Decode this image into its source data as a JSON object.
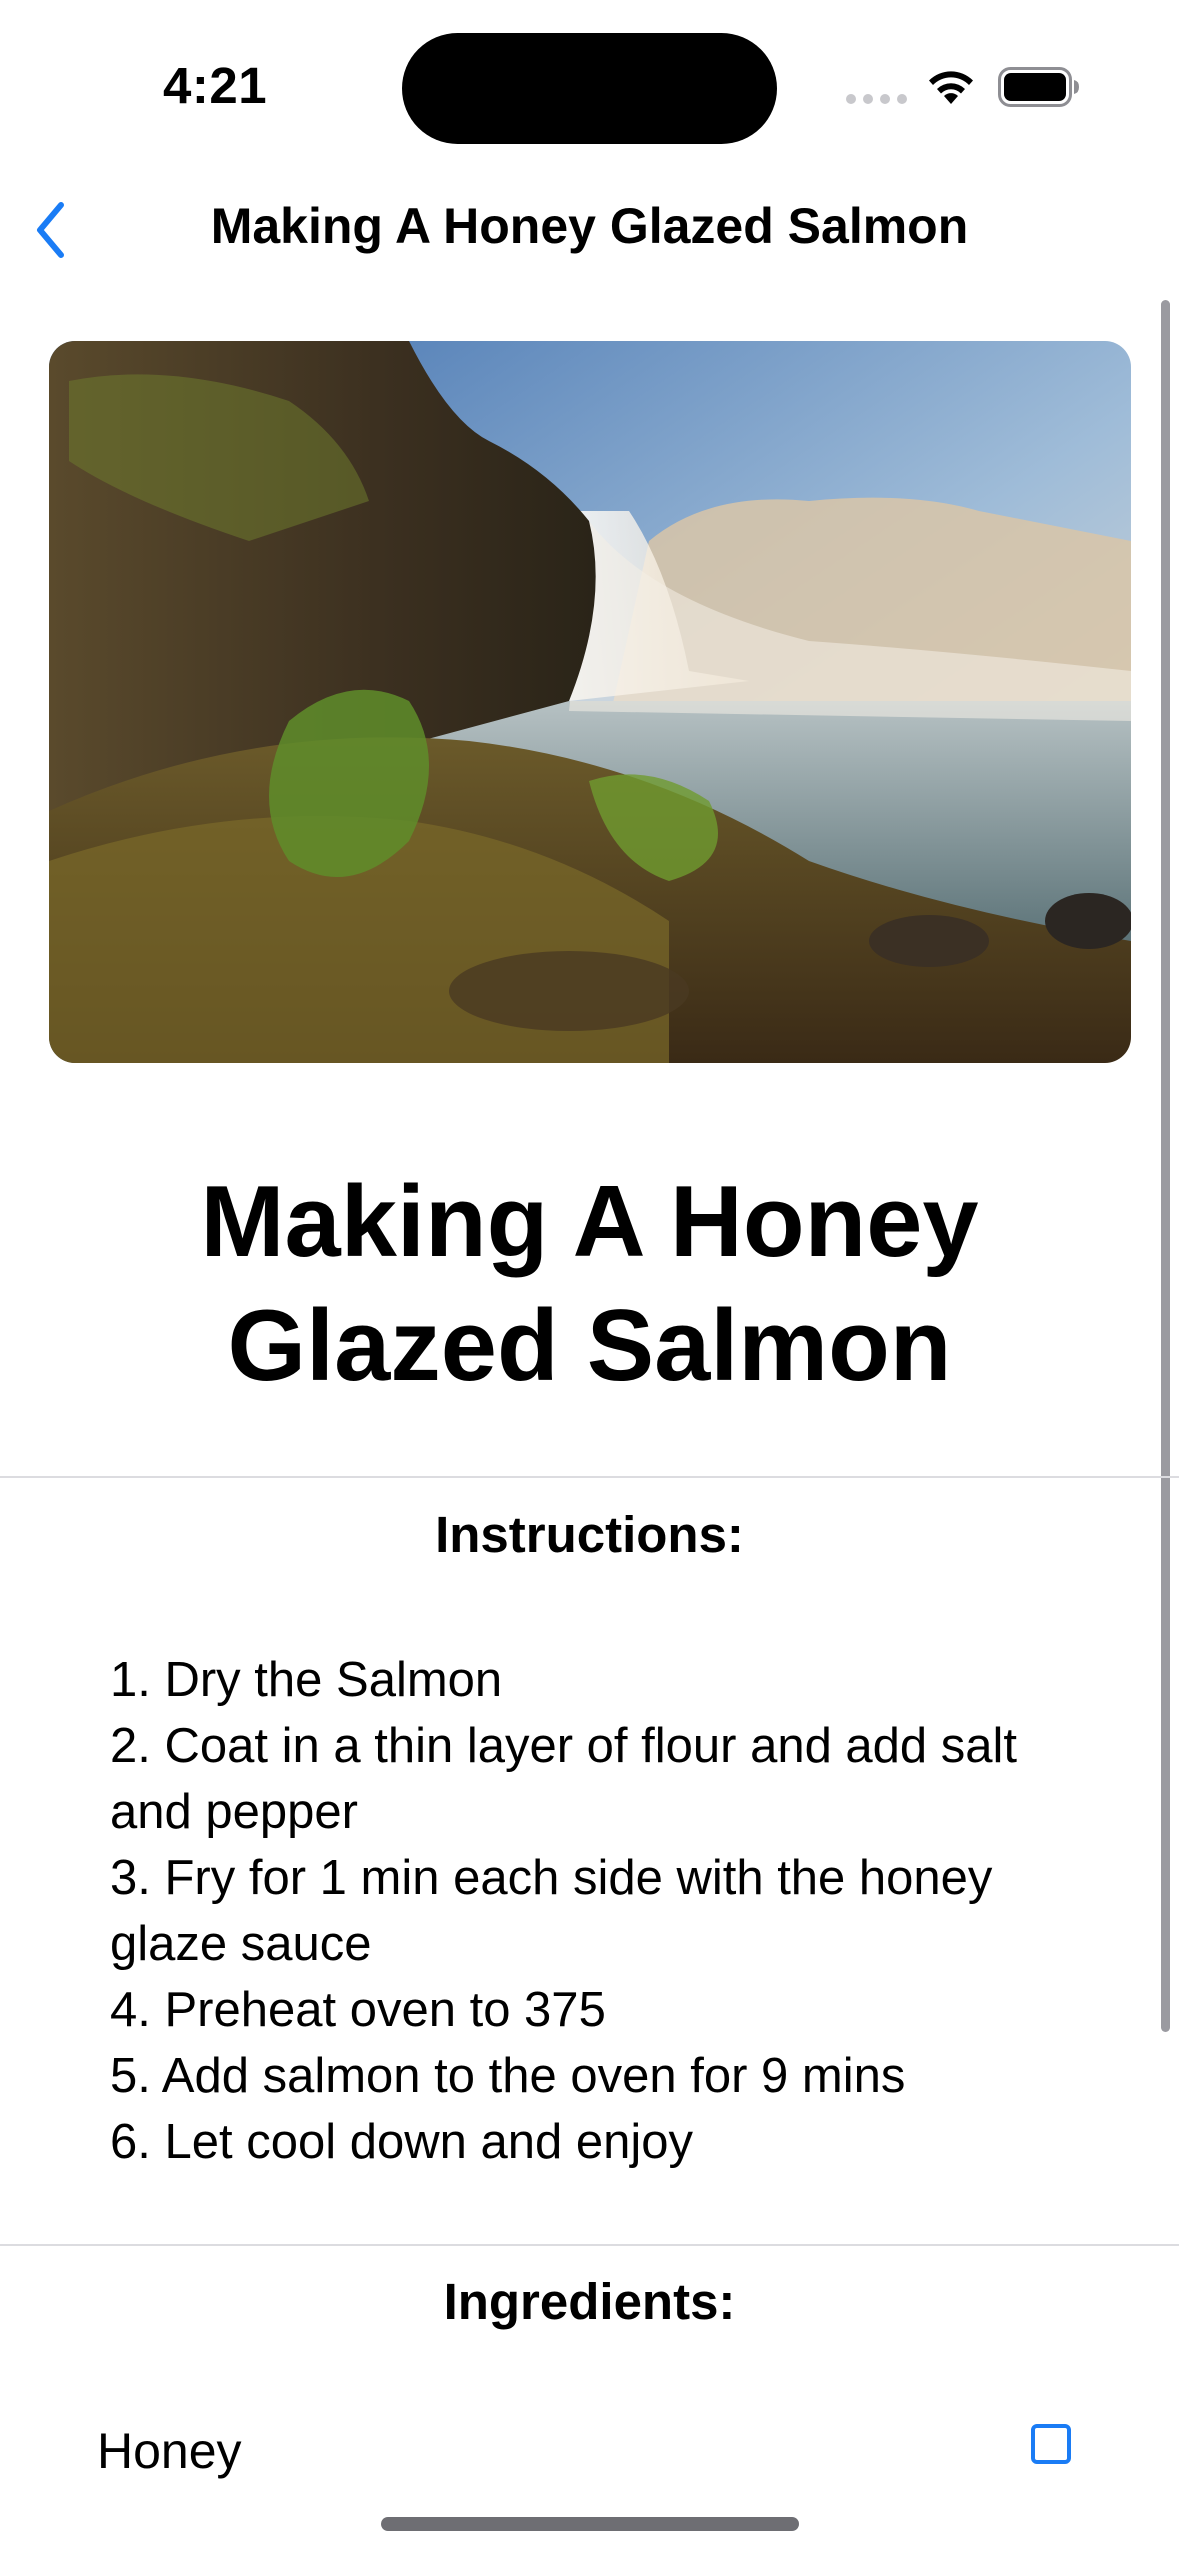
{
  "status_bar": {
    "time": "4:21"
  },
  "nav": {
    "back_icon": "chevron-left-icon",
    "title": "Making A Honey Glazed Salmon"
  },
  "hero_image": {
    "subject": "waterfall landscape photo"
  },
  "recipe": {
    "title_line1": "Making A Honey",
    "title_line2": "Glazed Salmon"
  },
  "instructions": {
    "heading": "Instructions:",
    "steps": [
      "1. Dry the Salmon",
      "2. Coat in a thin layer of flour and add salt and pepper",
      "3. Fry for 1 min each side with the honey glaze sauce",
      "4. Preheat oven to 375",
      "5. Add salmon to the oven for 9 mins",
      "6. Let cool down and enjoy"
    ]
  },
  "ingredients": {
    "heading": "Ingredients:",
    "items": [
      {
        "label": "Honey",
        "checked": false
      }
    ]
  },
  "colors": {
    "accent": "#1a7cf5",
    "divider": "#dcdce0"
  }
}
